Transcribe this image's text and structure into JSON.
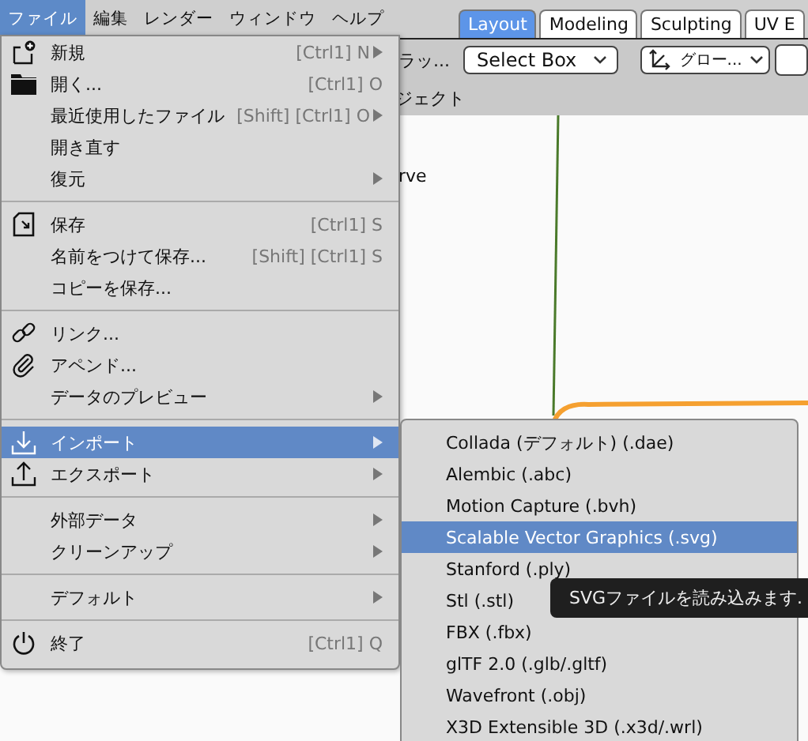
{
  "menubar": [
    {
      "label": "ファイル",
      "selected": true
    },
    {
      "label": "編集",
      "selected": false
    },
    {
      "label": "レンダー",
      "selected": false
    },
    {
      "label": "ウィンドウ",
      "selected": false
    },
    {
      "label": "ヘルプ",
      "selected": false
    }
  ],
  "workspace_tabs": [
    {
      "label": "Layout",
      "selected": true
    },
    {
      "label": "Modeling",
      "selected": false
    },
    {
      "label": "Sculpting",
      "selected": false
    },
    {
      "label": "UV E",
      "selected": false
    }
  ],
  "toolbar": {
    "left_text": "ラッ...",
    "select_mode": "Select Box",
    "orientation": "グロー..."
  },
  "header_text": "ジェクト",
  "viewport_text": "rve",
  "file_menu": [
    {
      "kind": "item",
      "label": "新規",
      "shortcut": "[Ctrl1] N",
      "submenu": true,
      "selected": false
    },
    {
      "kind": "item",
      "label": "開く...",
      "shortcut": "[Ctrl1] O",
      "submenu": false,
      "selected": false
    },
    {
      "kind": "item",
      "label": "最近使用したファイル",
      "shortcut": "[Shift] [Ctrl1] O",
      "submenu": true,
      "selected": false
    },
    {
      "kind": "item",
      "label": "開き直す",
      "submenu": false,
      "selected": false
    },
    {
      "kind": "item",
      "label": "復元",
      "submenu": true,
      "selected": false
    },
    {
      "kind": "separator"
    },
    {
      "kind": "item",
      "label": "保存",
      "shortcut": "[Ctrl1] S",
      "submenu": false,
      "selected": false
    },
    {
      "kind": "item",
      "label": "名前をつけて保存...",
      "shortcut": "[Shift] [Ctrl1] S",
      "submenu": false,
      "selected": false
    },
    {
      "kind": "item",
      "label": "コピーを保存...",
      "submenu": false,
      "selected": false
    },
    {
      "kind": "separator"
    },
    {
      "kind": "item",
      "label": "リンク...",
      "submenu": false,
      "selected": false
    },
    {
      "kind": "item",
      "label": "アペンド...",
      "submenu": false,
      "selected": false
    },
    {
      "kind": "item",
      "label": "データのプレビュー",
      "submenu": true,
      "selected": false
    },
    {
      "kind": "separator"
    },
    {
      "kind": "item",
      "label": "インポート",
      "submenu": true,
      "selected": true
    },
    {
      "kind": "item",
      "label": "エクスポート",
      "submenu": true,
      "selected": false
    },
    {
      "kind": "separator"
    },
    {
      "kind": "item",
      "label": "外部データ",
      "submenu": true,
      "selected": false
    },
    {
      "kind": "item",
      "label": "クリーンアップ",
      "submenu": true,
      "selected": false
    },
    {
      "kind": "separator"
    },
    {
      "kind": "item",
      "label": "デフォルト",
      "submenu": true,
      "selected": false
    },
    {
      "kind": "separator"
    },
    {
      "kind": "item",
      "label": "終了",
      "shortcut": "[Ctrl1] Q",
      "submenu": false,
      "selected": false
    }
  ],
  "import_menu": [
    {
      "label": "Collada (デフォルト) (.dae)",
      "selected": false
    },
    {
      "label": "Alembic (.abc)",
      "selected": false
    },
    {
      "label": "Motion Capture (.bvh)",
      "selected": false
    },
    {
      "label": "Scalable Vector Graphics (.svg)",
      "selected": true
    },
    {
      "label": "Stanford (.ply)",
      "selected": false
    },
    {
      "label": "Stl (.stl)",
      "selected": false
    },
    {
      "label": "FBX (.fbx)",
      "selected": false
    },
    {
      "label": "glTF 2.0 (.glb/.gltf)",
      "selected": false
    },
    {
      "label": "Wavefront (.obj)",
      "selected": false
    },
    {
      "label": "X3D Extensible 3D (.x3d/.wrl)",
      "selected": false
    }
  ],
  "tooltip": "SVGファイルを読み込みます."
}
